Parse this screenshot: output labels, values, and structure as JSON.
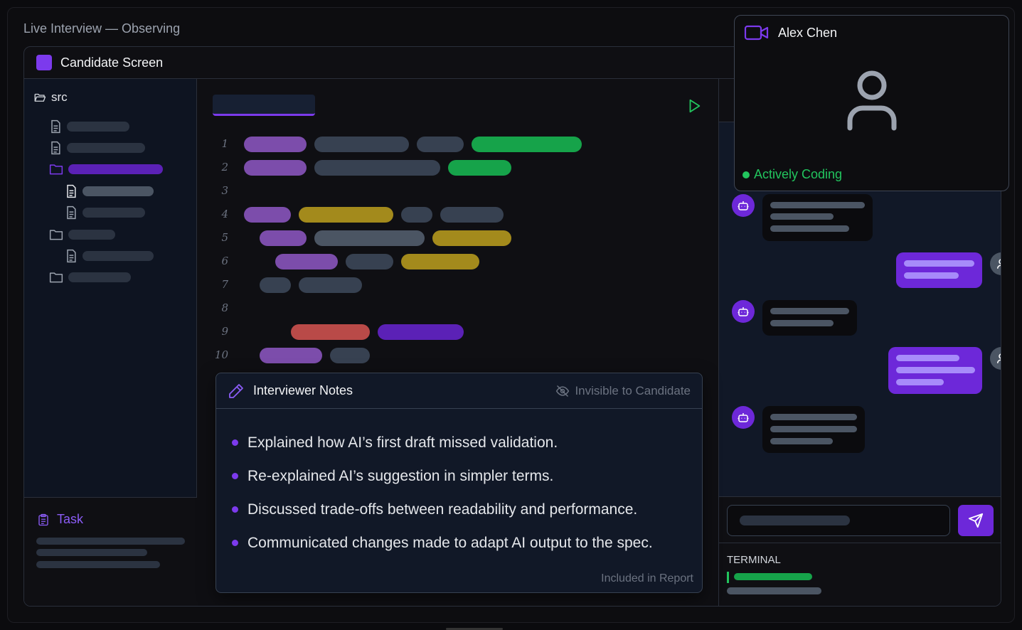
{
  "page": {
    "title": "Live Interview — Observing"
  },
  "screen": {
    "title": "Candidate Screen"
  },
  "sidebar": {
    "root_label": "src"
  },
  "task": {
    "label": "Task"
  },
  "notes": {
    "title": "Interviewer Notes",
    "visibility": "Invisible to Candidate",
    "items": [
      "Explained how AI’s first draft missed validation.",
      "Re-explained AI’s suggestion in simpler terms.",
      "Discussed trade-offs between readability and performance.",
      "Communicated changes made to adapt AI output to the spec."
    ],
    "footer": "Included in Report"
  },
  "editor": {
    "line_numbers": [
      "1",
      "2",
      "3",
      "4",
      "5",
      "6",
      "7",
      "8",
      "9",
      "10"
    ]
  },
  "terminal": {
    "label": "TERMINAL"
  },
  "video": {
    "name": "Alex Chen",
    "status": "Actively Coding"
  },
  "colors": {
    "accent": "#7c3aed",
    "success": "#22c55e",
    "background": "#0f0f13"
  },
  "icons": [
    "folder-open-icon",
    "file-icon",
    "folder-icon",
    "clipboard-icon",
    "pencil-icon",
    "eye-off-icon",
    "play-icon",
    "video-camera-icon",
    "user-icon",
    "robot-icon",
    "send-icon"
  ]
}
